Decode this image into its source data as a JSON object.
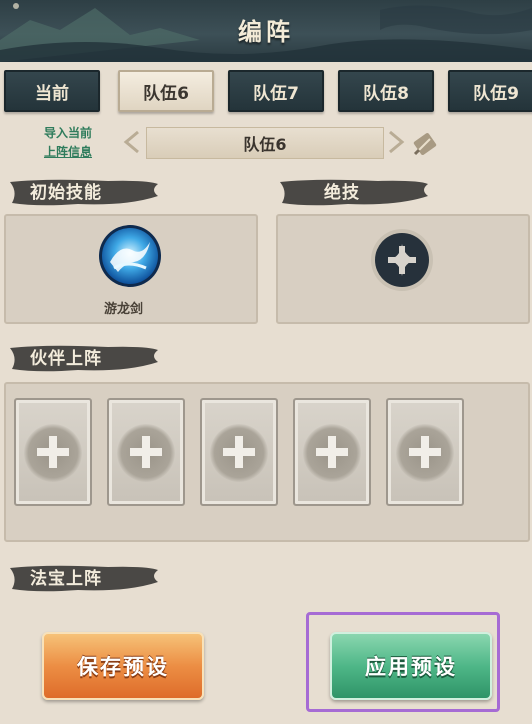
{
  "header": {
    "title": "编阵"
  },
  "tabs": [
    {
      "label": "当前",
      "active": false
    },
    {
      "label": "队伍6",
      "active": true
    },
    {
      "label": "队伍7",
      "active": false
    },
    {
      "label": "队伍8",
      "active": false
    },
    {
      "label": "队伍9",
      "active": false
    }
  ],
  "team_selector": {
    "import_line1": "导入当前",
    "import_line2": "上阵信息",
    "current_team": "队伍6",
    "prev_icon": "chevron-left-icon",
    "next_icon": "chevron-right-icon",
    "edit_icon": "pencil-icon"
  },
  "sections": {
    "initial_skill": "初始技能",
    "ultimate": "绝技",
    "partners": "伙伴上阵",
    "treasure": "法宝上阵"
  },
  "initial_skill": {
    "name": "游龙剑",
    "icon": "dragon-sword-icon"
  },
  "ultimate_slot": {
    "icon": "plus-icon"
  },
  "partner_slots": [
    {
      "icon": "plus-icon"
    },
    {
      "icon": "plus-icon"
    },
    {
      "icon": "plus-icon"
    },
    {
      "icon": "plus-icon"
    },
    {
      "icon": "plus-icon"
    }
  ],
  "buttons": {
    "save": "保存预设",
    "apply": "应用预设"
  },
  "colors": {
    "header_bg": "#34464d",
    "save_button": "#ec8e44",
    "apply_button": "#4fb788",
    "highlight_frame": "#a66bd4",
    "link_text": "#2f7c5c"
  }
}
